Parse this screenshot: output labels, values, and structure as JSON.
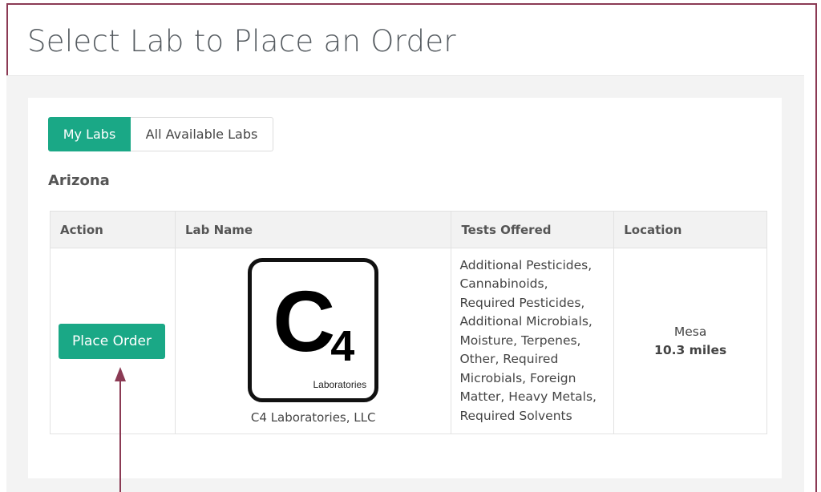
{
  "page": {
    "title": "Select Lab to Place an Order"
  },
  "tabs": {
    "my_labs": "My Labs",
    "all_labs": "All Available Labs"
  },
  "state": "Arizona",
  "table": {
    "headers": [
      "Action",
      "Lab Name",
      "Tests Offered",
      "Location"
    ],
    "rows": [
      {
        "action_label": "Place Order",
        "logo_letter": "C",
        "logo_number": "4",
        "logo_subtext": "Laboratories",
        "lab_name": "C4 Laboratories, LLC",
        "tests_offered": [
          "Additional Pesticides,",
          "Cannabinoids,",
          "Required Pesticides,",
          "Additional Microbials,",
          "Moisture, Terpenes,",
          "Other, Required",
          "Microbials, Foreign",
          "Matter, Heavy Metals,",
          "Required Solvents"
        ],
        "city": "Mesa",
        "distance": "10.3 miles"
      }
    ]
  },
  "colors": {
    "accent": "#1aa886",
    "frame_border": "#8b3a54",
    "arrow": "#8b3a54"
  }
}
